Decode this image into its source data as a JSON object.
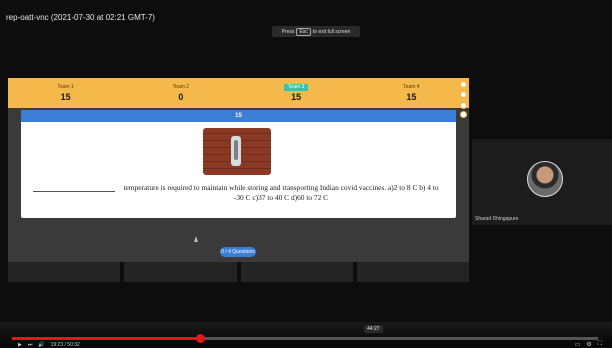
{
  "recording": {
    "title": "rep-oatt-vnc (2021-07-30 at 02:21 GMT-7)"
  },
  "toast": {
    "pre": "Press",
    "key": "Esc",
    "post": "to exit full screen"
  },
  "teams": [
    {
      "name": "Team 1",
      "score": "15",
      "active": false
    },
    {
      "name": "Team 2",
      "score": "0",
      "active": false
    },
    {
      "name": "Team 3",
      "score": "15",
      "active": true
    },
    {
      "name": "Team 4",
      "score": "15",
      "active": false
    }
  ],
  "question": {
    "number": "15",
    "text": "temperature is required to maintain while storing and transporting Indian covid vaccines. a)2 to 8 C b) 4 to -30 C c)37 to 40 C d)60 to 72 C",
    "action_label": "0 / 4 Questions"
  },
  "participant": {
    "name": "Sharad Dhingapure"
  },
  "player": {
    "tooltip_time": "44:27",
    "progress_percent": 32,
    "elapsed_label": "19:23 / 50:32"
  },
  "colors": {
    "team_bar": "#f5b84a",
    "active_team": "#3cbfae",
    "accent": "#3a7fd5",
    "progress": "#e01a1a"
  }
}
